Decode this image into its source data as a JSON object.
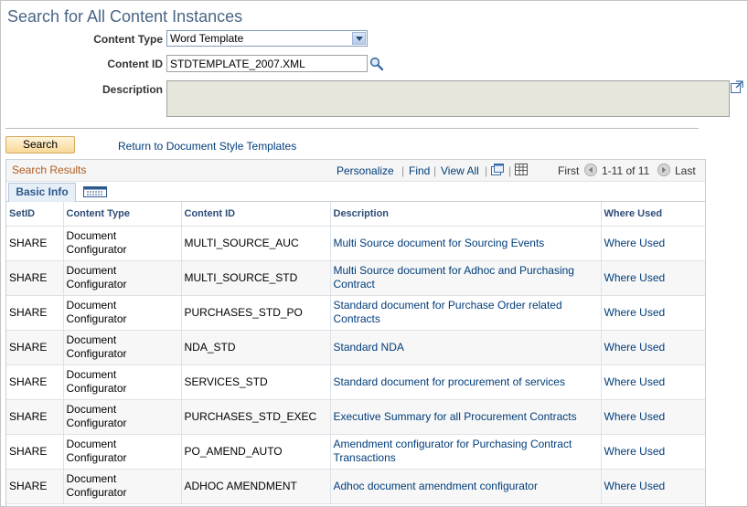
{
  "page": {
    "title": "Search for All Content Instances"
  },
  "form": {
    "content_type_label": "Content Type",
    "content_type_value": "Word Template",
    "content_id_label": "Content ID",
    "content_id_value": "STDTEMPLATE_2007.XML",
    "description_label": "Description",
    "description_value": ""
  },
  "actions": {
    "search_label": "Search",
    "return_link": "Return to Document Style Templates"
  },
  "grid": {
    "title": "Search Results",
    "personalize": "Personalize",
    "find": "Find",
    "view_all": "View All",
    "first": "First",
    "range": "1-11 of 11",
    "last": "Last",
    "tab_label": "Basic Info",
    "columns": [
      "SetID",
      "Content Type",
      "Content ID",
      "Description",
      "Where Used"
    ],
    "rows": [
      {
        "setid": "SHARE",
        "content_type": "Document Configurator",
        "content_id": "MULTI_SOURCE_AUC",
        "description": "Multi Source document for Sourcing Events",
        "where_used": "Where Used"
      },
      {
        "setid": "SHARE",
        "content_type": "Document Configurator",
        "content_id": "MULTI_SOURCE_STD",
        "description": "Multi Source document for Adhoc and Purchasing Contract",
        "where_used": "Where Used"
      },
      {
        "setid": "SHARE",
        "content_type": "Document Configurator",
        "content_id": "PURCHASES_STD_PO",
        "description": "Standard document for Purchase Order related Contracts",
        "where_used": "Where Used"
      },
      {
        "setid": "SHARE",
        "content_type": "Document Configurator",
        "content_id": "NDA_STD",
        "description": "Standard NDA",
        "where_used": "Where Used"
      },
      {
        "setid": "SHARE",
        "content_type": "Document Configurator",
        "content_id": "SERVICES_STD",
        "description": "Standard document for procurement of services",
        "where_used": "Where Used"
      },
      {
        "setid": "SHARE",
        "content_type": "Document Configurator",
        "content_id": "PURCHASES_STD_EXEC",
        "description": "Executive Summary for all Procurement Contracts",
        "where_used": "Where Used"
      },
      {
        "setid": "SHARE",
        "content_type": "Document Configurator",
        "content_id": "PO_AMEND_AUTO",
        "description": "Amendment configurator for Purchasing Contract Transactions",
        "where_used": "Where Used"
      },
      {
        "setid": "SHARE",
        "content_type": "Document Configurator",
        "content_id": "ADHOC AMENDMENT",
        "description": "Adhoc document amendment configurator",
        "where_used": "Where Used"
      }
    ]
  },
  "icons": {
    "lookup": "magnifier-icon",
    "expand": "expand-textarea-icon",
    "new_window": "new-window-icon",
    "download": "download-grid-icon",
    "prev": "previous-arrow-icon",
    "next": "next-arrow-icon",
    "show_all_columns": "show-all-columns-icon"
  },
  "colors": {
    "title": "#4a6586",
    "link": "#003d7a",
    "grid_title": "#b05a1a",
    "button": "#f8d898"
  }
}
